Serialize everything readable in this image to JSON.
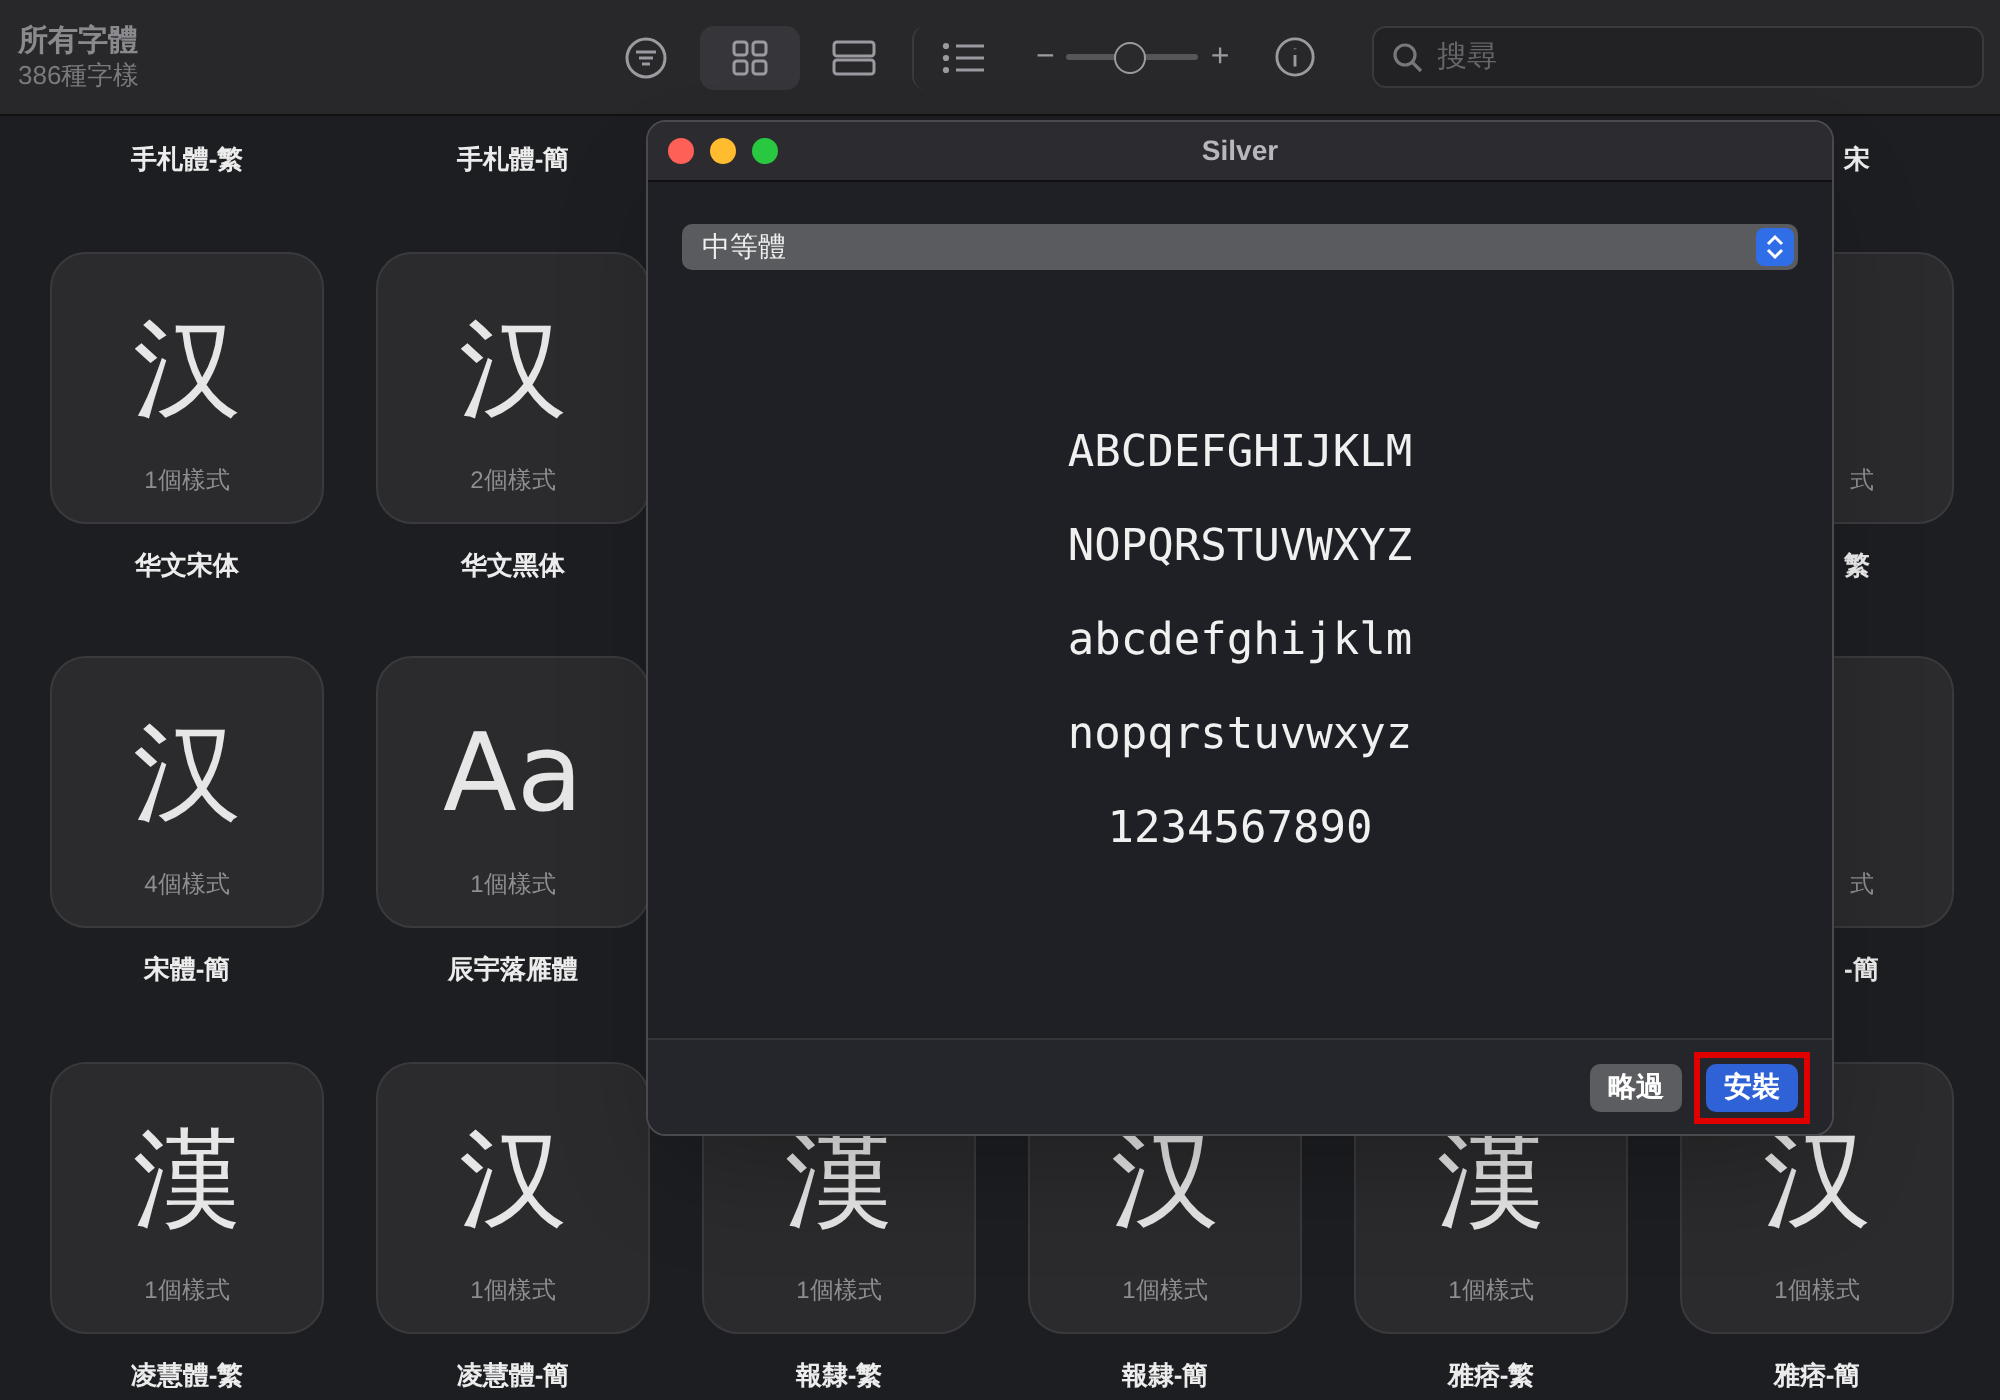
{
  "toolbar": {
    "title": "所有字體",
    "subtitle": "386種字樣",
    "views": [
      {
        "kind": "grid",
        "selected": true
      },
      {
        "kind": "rows",
        "selected": false
      },
      {
        "kind": "list",
        "selected": false
      }
    ],
    "zoom": {
      "minus": "−",
      "plus": "+",
      "level": 0.48
    },
    "search": {
      "placeholder": "搜尋"
    }
  },
  "top_row": [
    {
      "name": "手札體-繁",
      "cut": false
    },
    {
      "name": "手札體-簡",
      "cut": false
    },
    {
      "name": "宋",
      "cut": true
    }
  ],
  "rows": [
    [
      {
        "glyph": "汉",
        "count": "1個樣式",
        "name": "华文宋体",
        "cut": false
      },
      {
        "glyph": "汉",
        "count": "2個樣式",
        "name": "华文黑体",
        "cut": false
      },
      null,
      null,
      null,
      {
        "count": "式",
        "name": "繁",
        "cut": true
      }
    ],
    [
      {
        "glyph": "汉",
        "count": "4個樣式",
        "name": "宋體-簡",
        "cut": false
      },
      {
        "glyph": "Aa",
        "count": "1個樣式",
        "name": "辰宇落雁體",
        "cut": false
      },
      null,
      null,
      null,
      {
        "count": "式",
        "name": "-簡",
        "cut": true
      }
    ],
    [
      {
        "glyph": "漢",
        "count": "1個樣式",
        "name": "凌慧體-繁",
        "cut": false
      },
      {
        "glyph": "汉",
        "count": "1個樣式",
        "name": "凌慧體-簡",
        "cut": false
      },
      {
        "glyph": "漢",
        "count": "1個樣式",
        "name": "報隸-繁",
        "cut": false
      },
      {
        "glyph": "汉",
        "count": "1個樣式",
        "name": "報隸-簡",
        "cut": false
      },
      {
        "glyph": "漢",
        "count": "1個樣式",
        "name": "雅痞-繁",
        "cut": false
      },
      {
        "glyph": "汉",
        "count": "1個樣式",
        "name": "雅痞-簡",
        "cut": false
      }
    ]
  ],
  "dialog": {
    "title": "Silver",
    "select": "中等體",
    "sample_lines": [
      "ABCDEFGHIJKLM",
      "NOPQRSTUVWXYZ",
      "abcdefghijklm",
      "nopqrstuvwxyz",
      "1234567890"
    ],
    "buttons": [
      {
        "label": "略過",
        "kind": "secondary",
        "highlighted": false
      },
      {
        "label": "安裝",
        "kind": "primary",
        "highlighted": true
      }
    ]
  }
}
